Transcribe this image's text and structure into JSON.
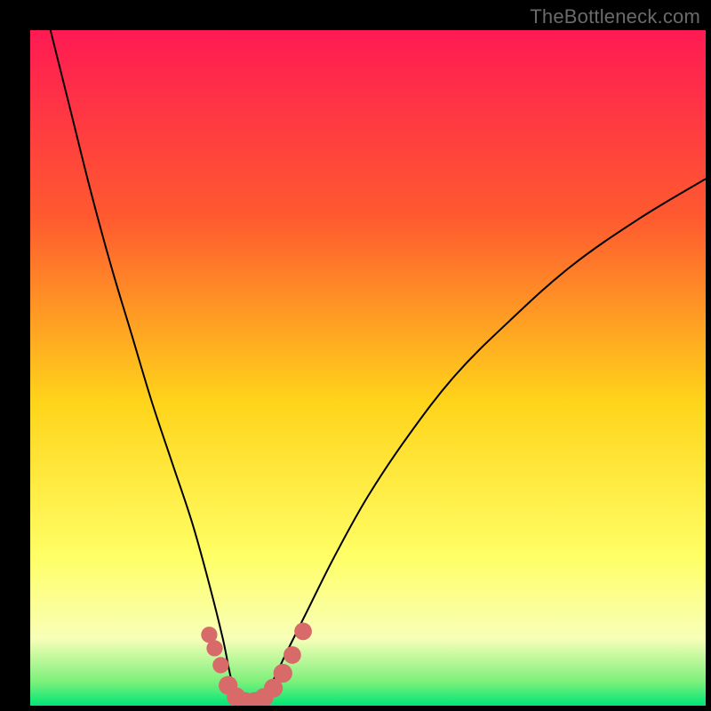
{
  "watermark": "TheBottleneck.com",
  "chart_data": {
    "type": "line",
    "title": "",
    "xlabel": "",
    "ylabel": "",
    "xlim": [
      0,
      100
    ],
    "ylim": [
      0,
      100
    ],
    "grid": false,
    "legend": false,
    "background_gradient": {
      "stops": [
        {
          "offset": 0.0,
          "color": "#ff1a53"
        },
        {
          "offset": 0.28,
          "color": "#ff5b2f"
        },
        {
          "offset": 0.55,
          "color": "#ffd41a"
        },
        {
          "offset": 0.78,
          "color": "#ffff66"
        },
        {
          "offset": 0.9,
          "color": "#f8ffb8"
        },
        {
          "offset": 0.965,
          "color": "#7bf07b"
        },
        {
          "offset": 1.0,
          "color": "#00e676"
        }
      ]
    },
    "series": [
      {
        "name": "bottleneck-curve",
        "x": [
          3,
          6,
          9,
          12,
          15,
          18,
          21,
          24,
          26.5,
          28.5,
          30,
          31.5,
          33,
          35.5,
          38,
          41,
          45,
          50,
          56,
          63,
          71,
          80,
          90,
          100
        ],
        "y": [
          100,
          88,
          76,
          65,
          55,
          45,
          36,
          27,
          18,
          10,
          3,
          0.5,
          0.5,
          3,
          8,
          14,
          22,
          31,
          40,
          49,
          57,
          65,
          72,
          78
        ]
      }
    ],
    "markers": {
      "name": "highlight-points",
      "color": "#d96a6a",
      "points": [
        {
          "x": 26.5,
          "y": 10.5,
          "r": 1.2
        },
        {
          "x": 27.3,
          "y": 8.5,
          "r": 1.2
        },
        {
          "x": 28.2,
          "y": 6.0,
          "r": 1.2
        },
        {
          "x": 29.3,
          "y": 3.0,
          "r": 1.4
        },
        {
          "x": 30.5,
          "y": 1.3,
          "r": 1.4
        },
        {
          "x": 31.8,
          "y": 0.6,
          "r": 1.4
        },
        {
          "x": 33.2,
          "y": 0.6,
          "r": 1.4
        },
        {
          "x": 34.6,
          "y": 1.2,
          "r": 1.4
        },
        {
          "x": 36.0,
          "y": 2.6,
          "r": 1.4
        },
        {
          "x": 37.4,
          "y": 4.8,
          "r": 1.4
        },
        {
          "x": 38.8,
          "y": 7.5,
          "r": 1.3
        },
        {
          "x": 40.4,
          "y": 11.0,
          "r": 1.3
        }
      ]
    }
  }
}
